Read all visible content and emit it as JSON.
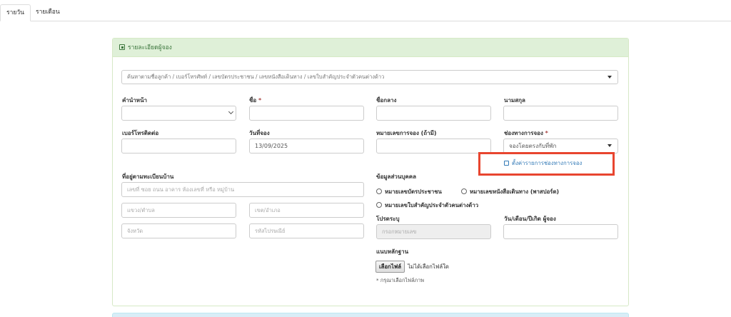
{
  "tabs": [
    {
      "label": "รายวัน",
      "active": true
    },
    {
      "label": "รายเดือน",
      "active": false
    }
  ],
  "panel": {
    "title": "รายละเอียดผู้จอง",
    "search_placeholder": "ค้นหาตามชื่อลูกค้า / เบอร์โทรศัพท์ / เลขบัตรประชาชน / เลขหนังสือเดินทาง / เลขใบสำคัญประจำตัวคนต่างด้าว"
  },
  "fields": {
    "prefix": {
      "label": "คำนำหน้า",
      "value": ""
    },
    "first_name": {
      "label": "ชื่อ",
      "required_mark": "*",
      "value": ""
    },
    "middle_name": {
      "label": "ชื่อกลาง",
      "value": ""
    },
    "last_name": {
      "label": "นามสกุล",
      "value": ""
    },
    "phone": {
      "label": "เบอร์โทรติดต่อ",
      "value": ""
    },
    "booking_date": {
      "label": "วันที่จอง",
      "value": "13/09/2025"
    },
    "booking_ref": {
      "label": "หมายเลขการจอง (ถ้ามี)",
      "value": ""
    },
    "channel": {
      "label": "ช่องทางการจอง",
      "required_mark": "*",
      "value": "จองโดยตรงกับที่พัก"
    },
    "channel_link": "ตั้งค่ารายการช่องทางการจอง"
  },
  "address": {
    "label": "ที่อยู่ตามทะเบียนบ้าน",
    "line_placeholder": "เลขที่ ซอย ถนน อาคาร ห้องเลขที่ หรือ หมู่บ้าน",
    "subdistrict_placeholder": "แขวง/ตำบล",
    "district_placeholder": "เขต/อำเภอ",
    "province_placeholder": "จังหวัด",
    "postcode_placeholder": "รหัสไปรษณีย์"
  },
  "personal": {
    "label": "ข้อมูลส่วนบุคคล",
    "options": [
      "หมายเลขบัตรประชาชน",
      "หมายเลขหนังสือเดินทาง (พาสปอร์ต)",
      "หมายเลขใบสำคัญประจำตัวคนต่างด้าว"
    ],
    "specify_label": "โปรดระบุ",
    "specify_placeholder": "กรอกหมายเลข",
    "dob_label": "วัน/เดือน/ปีเกิด ผู้จอง",
    "dob_value": ""
  },
  "attachment": {
    "label": "แนบหลักฐาน",
    "button": "เลือกไฟล์",
    "status": "ไม่ได้เลือกไฟล์ใด",
    "hint": "* กรุณาเลือกไฟล์ภาพ"
  },
  "colors": {
    "panel_header_bg": "#dff0d8",
    "link": "#337ab7",
    "required": "#a94442",
    "highlight_box": "#e8452f"
  }
}
